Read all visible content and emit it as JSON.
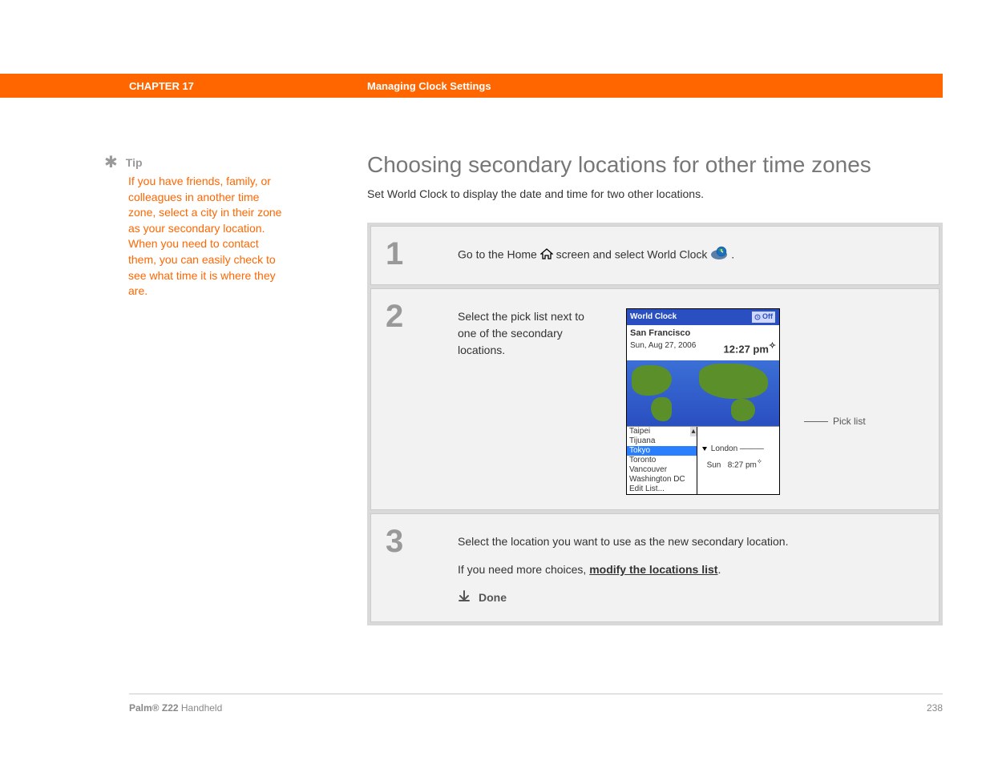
{
  "header": {
    "chapter": "CHAPTER 17",
    "topic": "Managing Clock Settings"
  },
  "sidebar": {
    "tip_label": "Tip",
    "tip_body": "If you have friends, family, or colleagues in another time zone, select a city in their zone as your secondary location. When you need to contact them, you can easily check to see what time it is where they are."
  },
  "main": {
    "title": "Choosing secondary locations for other time zones",
    "subtitle": "Set World Clock to display the date and time for two other locations."
  },
  "steps": [
    {
      "num": "1",
      "text_before": "Go to the Home ",
      "text_mid": " screen and select World Clock ",
      "text_after": "."
    },
    {
      "num": "2",
      "text": "Select the pick list next to one of the secondary locations."
    },
    {
      "num": "3",
      "line1": "Select the location you want to use as the new secondary location.",
      "line2_before": "If you need more choices, ",
      "line2_link": "modify the locations list",
      "line2_after": ".",
      "done": "Done"
    }
  ],
  "device": {
    "title": "World Clock",
    "off_label": "Off",
    "primary_city": "San Francisco",
    "primary_date": "Sun, Aug 27, 2006",
    "primary_time": "12:27 pm",
    "pick_items": [
      "Taipei",
      "Tijuana",
      "Tokyo",
      "Toronto",
      "Vancouver",
      "Washington DC",
      "Edit List..."
    ],
    "selected_item": "Tokyo",
    "secondary_city": "London",
    "secondary_day": "Sun",
    "secondary_time": "8:27 pm"
  },
  "callout": {
    "label": "Pick list"
  },
  "footer": {
    "product_bold": "Palm® Z22",
    "product_rest": " Handheld",
    "page": "238"
  }
}
